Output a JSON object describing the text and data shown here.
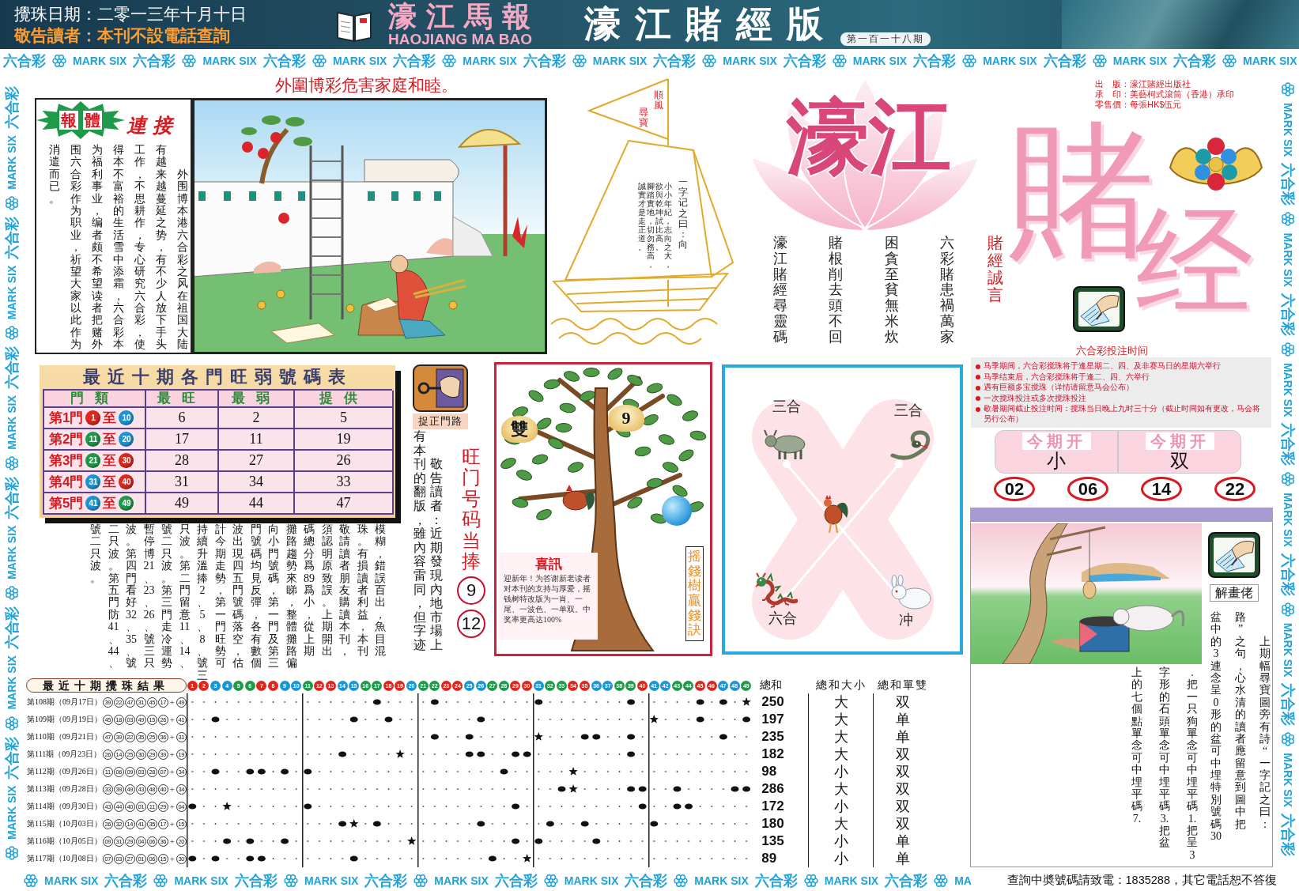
{
  "header": {
    "draw_date": "攪珠日期：二零一三年十月十日",
    "notice": "敬告讀者：本刊不設電話查詢",
    "paper_name": "濠江馬報",
    "paper_name_latin": "HAOJIANG MA BAO",
    "edition": "濠江賭經版",
    "issue": "第一百一十八期"
  },
  "border": {
    "top": [
      "六合彩",
      "MARK SIX",
      "六合彩",
      "MARK SIX",
      "六合彩",
      "MARK SIX",
      "六合彩",
      "MARK SIX",
      "六合彩",
      "MARK SIX",
      "六合彩",
      "MARK SIX",
      "六合彩",
      "MARK SIX",
      "六合彩",
      "MARK SIX",
      "六合彩",
      "MARK SIX",
      "六合彩",
      "MARK SIX"
    ],
    "left": [
      "MARK SIX",
      "六合彩",
      "MARK SIX",
      "六合彩",
      "MARK SIX",
      "六合彩",
      "MARK SIX",
      "六合彩",
      "MARK SIX",
      "六合彩",
      "MARK SIX",
      "六合彩"
    ],
    "right": [
      "MARK SIX",
      "六合彩",
      "MARK SIX",
      "六合彩",
      "MARK SIX",
      "六合彩",
      "MARK SIX",
      "六合彩",
      "MARK SIX",
      "六合彩",
      "MARK SIX",
      "六合彩"
    ],
    "bottom": [
      "MARK SIX",
      "六合彩",
      "MARK SIX",
      "六合彩",
      "MARK SIX",
      "六合彩",
      "MARK SIX",
      "六合彩",
      "MARK SIX",
      "六合彩",
      "MARK SIX",
      "六合彩",
      "MARK SIX",
      "六合彩",
      "MA"
    ]
  },
  "feature": {
    "headline": "外圍博彩危害家庭和睦。",
    "badge": [
      "報",
      "體"
    ],
    "badge_tail": "連接",
    "columns": [
      "消遣而已。",
      "围六合彩作为职业，祈望大家以此作为",
      "为福利事业，编者颇不希望读者把赌外",
      "得本不富裕的生活雪中添霜，六合彩本",
      "工作，不思耕作，专心研究六合彩，使",
      "有越来越蔓延之势，有不少人放下手头",
      "外围博本港六合彩之风在祖国大陆"
    ]
  },
  "boat": {
    "flag": [
      "順風",
      "尋寶"
    ],
    "columns": [
      "誠實才是走正道。",
      "腳踏實地，切勿務高，",
      "欲與乾坤試比高。",
      "小小年紀，志向之大，",
      "一字记之曰：向"
    ]
  },
  "logo": {
    "lotus_text": "濠江",
    "big_1": "賭",
    "big_2": "经"
  },
  "publisher": [
    "出　版：濠江賭經出版社",
    "承　印：美藝柯式滾筒（香港）承印",
    "零售價：每張HK$伍元"
  ],
  "motto": {
    "title": "賭經誠言",
    "columns": [
      "濠江賭經尋靈碼",
      "賭根削去頭不回",
      "困貪至貧無米炊",
      "六彩賭患禍萬家"
    ]
  },
  "schedule": {
    "title": "六合彩投注时间",
    "items": [
      "马季期间，六合彩搅珠将于逢星期二、四、及非赛马日的星期六举行",
      "马季结束后，六合彩搅珠将于逢二、四、六举行",
      "遇有巨额多宝搅珠（详情请留意马会公布）",
      "一次搅珠投注或多次搅珠投注",
      "歇暑期间截止投注时间：搅珠当日晚上九时三十分（截止时间如有更改，马会将另行公布）"
    ]
  },
  "door_table": {
    "title": "最近十期各門旺弱號碼表",
    "columns": [
      "門類",
      "最旺",
      "最弱",
      "提供"
    ],
    "rows": [
      {
        "door": "第1門",
        "from": {
          "number": "1",
          "color": "#e0251b"
        },
        "to_word": "至",
        "to": {
          "number": "10",
          "color": "#1b95d4"
        },
        "values": [
          "6",
          "2",
          "5"
        ]
      },
      {
        "door": "第2門",
        "from": {
          "number": "11",
          "color": "#1e9a4a"
        },
        "to_word": "至",
        "to": {
          "number": "20",
          "color": "#1b95d4"
        },
        "values": [
          "17",
          "11",
          "19"
        ]
      },
      {
        "door": "第3門",
        "from": {
          "number": "21",
          "color": "#1e9a4a"
        },
        "to_word": "至",
        "to": {
          "number": "30",
          "color": "#e0251b"
        },
        "values": [
          "28",
          "27",
          "26"
        ]
      },
      {
        "door": "第4門",
        "from": {
          "number": "31",
          "color": "#1b95d4"
        },
        "to_word": "至",
        "to": {
          "number": "40",
          "color": "#e0251b"
        },
        "values": [
          "31",
          "34",
          "33"
        ]
      },
      {
        "door": "第5門",
        "from": {
          "number": "41",
          "color": "#1b95d4"
        },
        "to_word": "至",
        "to": {
          "number": "49",
          "color": "#1e9a4a"
        },
        "values": [
          "49",
          "44",
          "47"
        ]
      }
    ]
  },
  "door_tip": {
    "label": "捉正門路"
  },
  "door_article": {
    "columns": [
      "號二只波。",
      "二只波。第五門防41、44、",
      "波。第四門看好32、35、號",
      "暫停博21、23、26、號三只",
      "號二只波。第三門走冷運勢",
      "只波。第二門留意11、14、",
      "持續升溫捧2、5、8、號三",
      "計今期走勢，第一門旺勢可",
      "波出現四五門號碼落空，估",
      "門號碼均見反彈，各有數個",
      "向小門號碼，第一門及第三",
      "攤路趨勢來睇，整體攤路偏",
      "碼總分爲89爲小，從上期",
      "須認明原致誤。上期開出",
      "敬請讀者朋友購讀本刊，",
      "珠。有損讀者利益，本刊",
      "模糊，錯誤百出，魚目混",
      "有本刊的翻版，雖內容雷同，但字迹",
      "敬告讀者：近期發現內地市場上"
    ]
  },
  "hot_numbers": {
    "title": "旺门号码当捧",
    "numbers": [
      "9",
      "12"
    ]
  },
  "money_tree": {
    "ingots": [
      "雙",
      "9"
    ],
    "notice": {
      "title": "喜訊",
      "text": "迎新年！为答谢新老读者对本刊的支持与厚爱，摇钱树特改版为一肖、一尾、一波色、一单双。中奖率更高达100%"
    },
    "caption": "摇錢樹贏錢訣"
  },
  "zodiac": {
    "labels": [
      "三合",
      "三合",
      "六合",
      "冲"
    ]
  },
  "this_draw": {
    "cells": [
      {
        "label": "今期开",
        "value": "小"
      },
      {
        "label": "今期开",
        "value": "双"
      }
    ],
    "numbers": [
      "02",
      "06",
      "14",
      "22"
    ]
  },
  "riddle": {
    "label": "解畫佬",
    "columns": [
      "上的七個點單念可中埋平碼7.",
      "字形的石頭單念可中埋平碼3.把盆",
      ".把一只狗單念可中埋平碼1.把呈3",
      "盆中的3連念呈0形的盆可中埋特別號碼30",
      "路”之句，心水清的讀者應留意到圖中把",
      "上期幅尋寶圖旁有詩“一字記之曰："
    ]
  },
  "results": {
    "title": "最近十期攪珠結果",
    "ball_header": [
      {
        "number": "1",
        "color": "#e0251b"
      },
      {
        "number": "2",
        "color": "#e0251b"
      },
      {
        "number": "3",
        "color": "#1b95d4"
      },
      {
        "number": "4",
        "color": "#1b95d4"
      },
      {
        "number": "5",
        "color": "#1e9a4a"
      },
      {
        "number": "6",
        "color": "#1e9a4a"
      },
      {
        "number": "7",
        "color": "#e0251b"
      },
      {
        "number": "8",
        "color": "#e0251b"
      },
      {
        "number": "9",
        "color": "#1b95d4"
      },
      {
        "number": "10",
        "color": "#1b95d4"
      },
      {
        "number": "11",
        "color": "#1e9a4a"
      },
      {
        "number": "12",
        "color": "#e0251b"
      },
      {
        "number": "13",
        "color": "#e0251b"
      },
      {
        "number": "14",
        "color": "#1b95d4"
      },
      {
        "number": "15",
        "color": "#1b95d4"
      },
      {
        "number": "16",
        "color": "#1e9a4a"
      },
      {
        "number": "17",
        "color": "#1e9a4a"
      },
      {
        "number": "18",
        "color": "#e0251b"
      },
      {
        "number": "19",
        "color": "#e0251b"
      },
      {
        "number": "20",
        "color": "#1b95d4"
      },
      {
        "number": "21",
        "color": "#1e9a4a"
      },
      {
        "number": "22",
        "color": "#1e9a4a"
      },
      {
        "number": "23",
        "color": "#e0251b"
      },
      {
        "number": "24",
        "color": "#e0251b"
      },
      {
        "number": "25",
        "color": "#1b95d4"
      },
      {
        "number": "26",
        "color": "#1b95d4"
      },
      {
        "number": "27",
        "color": "#1e9a4a"
      },
      {
        "number": "28",
        "color": "#1e9a4a"
      },
      {
        "number": "29",
        "color": "#e0251b"
      },
      {
        "number": "30",
        "color": "#e0251b"
      },
      {
        "number": "31",
        "color": "#1b95d4"
      },
      {
        "number": "32",
        "color": "#1e9a4a"
      },
      {
        "number": "33",
        "color": "#1e9a4a"
      },
      {
        "number": "34",
        "color": "#e0251b"
      },
      {
        "number": "35",
        "color": "#e0251b"
      },
      {
        "number": "36",
        "color": "#1b95d4"
      },
      {
        "number": "37",
        "color": "#1b95d4"
      },
      {
        "number": "38",
        "color": "#1e9a4a"
      },
      {
        "number": "39",
        "color": "#1e9a4a"
      },
      {
        "number": "40",
        "color": "#e0251b"
      },
      {
        "number": "41",
        "color": "#1b95d4"
      },
      {
        "number": "42",
        "color": "#1b95d4"
      },
      {
        "number": "43",
        "color": "#1e9a4a"
      },
      {
        "number": "44",
        "color": "#1e9a4a"
      },
      {
        "number": "45",
        "color": "#e0251b"
      },
      {
        "number": "46",
        "color": "#e0251b"
      },
      {
        "number": "47",
        "color": "#1b95d4"
      },
      {
        "number": "48",
        "color": "#1b95d4"
      },
      {
        "number": "49",
        "color": "#1e9a4a"
      }
    ],
    "columns": [
      "總和",
      "總和大小",
      "總和單雙"
    ],
    "rows": [
      {
        "period": "第108期（09月17日）",
        "balls": [
          "39",
          "22",
          "47",
          "31",
          "45",
          "17"
        ],
        "plus": "+",
        "special": "49",
        "sum": "250",
        "size": "大",
        "parity": "双"
      },
      {
        "period": "第109期（09月19日）",
        "balls": [
          "45",
          "18",
          "03",
          "49",
          "15",
          "26"
        ],
        "plus": "+",
        "special": "41",
        "sum": "197",
        "size": "大",
        "parity": "单"
      },
      {
        "period": "第110期（09月21日）",
        "balls": [
          "47",
          "39",
          "22",
          "35",
          "25",
          "36"
        ],
        "plus": "+",
        "special": "31",
        "sum": "235",
        "size": "大",
        "parity": "单"
      },
      {
        "period": "第111期（09月23日）",
        "balls": [
          "26",
          "14",
          "25",
          "30",
          "29",
          "39"
        ],
        "plus": "+",
        "special": "19",
        "sum": "182",
        "size": "大",
        "parity": "双"
      },
      {
        "period": "第112期（09月26日）",
        "balls": [
          "11",
          "06",
          "09",
          "03",
          "28",
          "07"
        ],
        "plus": "+",
        "special": "34",
        "sum": "98",
        "size": "小",
        "parity": "双"
      },
      {
        "period": "第113期（09月28日）",
        "balls": [
          "33",
          "39",
          "49",
          "43",
          "48",
          "40"
        ],
        "plus": "+",
        "special": "34",
        "sum": "286",
        "size": "大",
        "parity": "双"
      },
      {
        "period": "第114期（09月30日）",
        "balls": [
          "43",
          "44",
          "40",
          "01",
          "11",
          "29"
        ],
        "plus": "+",
        "special": "04",
        "sum": "172",
        "size": "小",
        "parity": "双"
      },
      {
        "period": "第115期（10月03日）",
        "balls": [
          "26",
          "32",
          "14",
          "41",
          "35",
          "17"
        ],
        "plus": "+",
        "special": "15",
        "sum": "180",
        "size": "大",
        "parity": "双"
      },
      {
        "period": "第116期（10月05日）",
        "balls": [
          "09",
          "31",
          "29",
          "04",
          "06",
          "36"
        ],
        "plus": "+",
        "special": "20",
        "sum": "135",
        "size": "小",
        "parity": "单"
      },
      {
        "period": "第117期（10月08日）",
        "balls": [
          "07",
          "03",
          "27",
          "01",
          "06",
          "15"
        ],
        "plus": "+",
        "special": "30",
        "sum": "89",
        "size": "小",
        "parity": "单"
      }
    ]
  },
  "footer": "查詢中奬號碼請致電：1835288，其它電話恕不答復"
}
